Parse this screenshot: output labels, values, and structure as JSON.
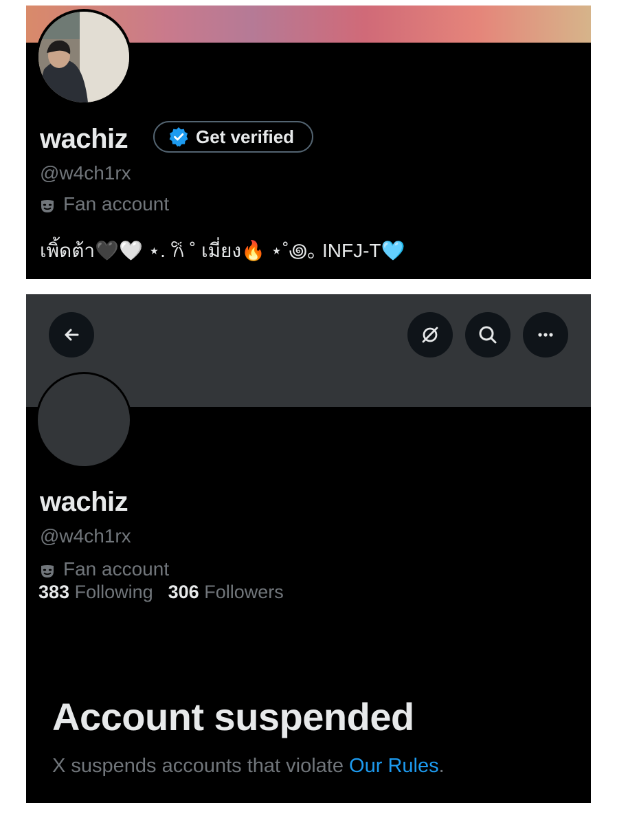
{
  "top_profile": {
    "name": "wachiz",
    "verify_button": "Get verified",
    "handle": "@w4ch1rx",
    "category": "Fan account",
    "category_icon": "theater-mask-icon",
    "bio": "เพิ้ดต้า🖤🤍 ⋆. 𐙚 ˚ เมี่ยง🔥 ⋆˚꩜｡ INFJ-T🩵"
  },
  "suspended_profile": {
    "name": "wachiz",
    "handle": "@w4ch1rx",
    "category": "Fan account",
    "following_count": "383",
    "following_label": "Following",
    "followers_count": "306",
    "followers_label": "Followers",
    "toolbar": {
      "back_icon": "arrow-left-icon",
      "grok_icon": "grok-icon",
      "search_icon": "search-icon",
      "more_icon": "more-icon"
    },
    "suspended_title": "Account suspended",
    "suspended_text_before": "X suspends accounts that violate ",
    "suspended_link": "Our Rules",
    "suspended_text_after": "."
  },
  "colors": {
    "background": "#000000",
    "text_primary": "#e7e9ea",
    "text_secondary": "#71767b",
    "link": "#1d9bf0",
    "banner_gray": "#333639"
  }
}
